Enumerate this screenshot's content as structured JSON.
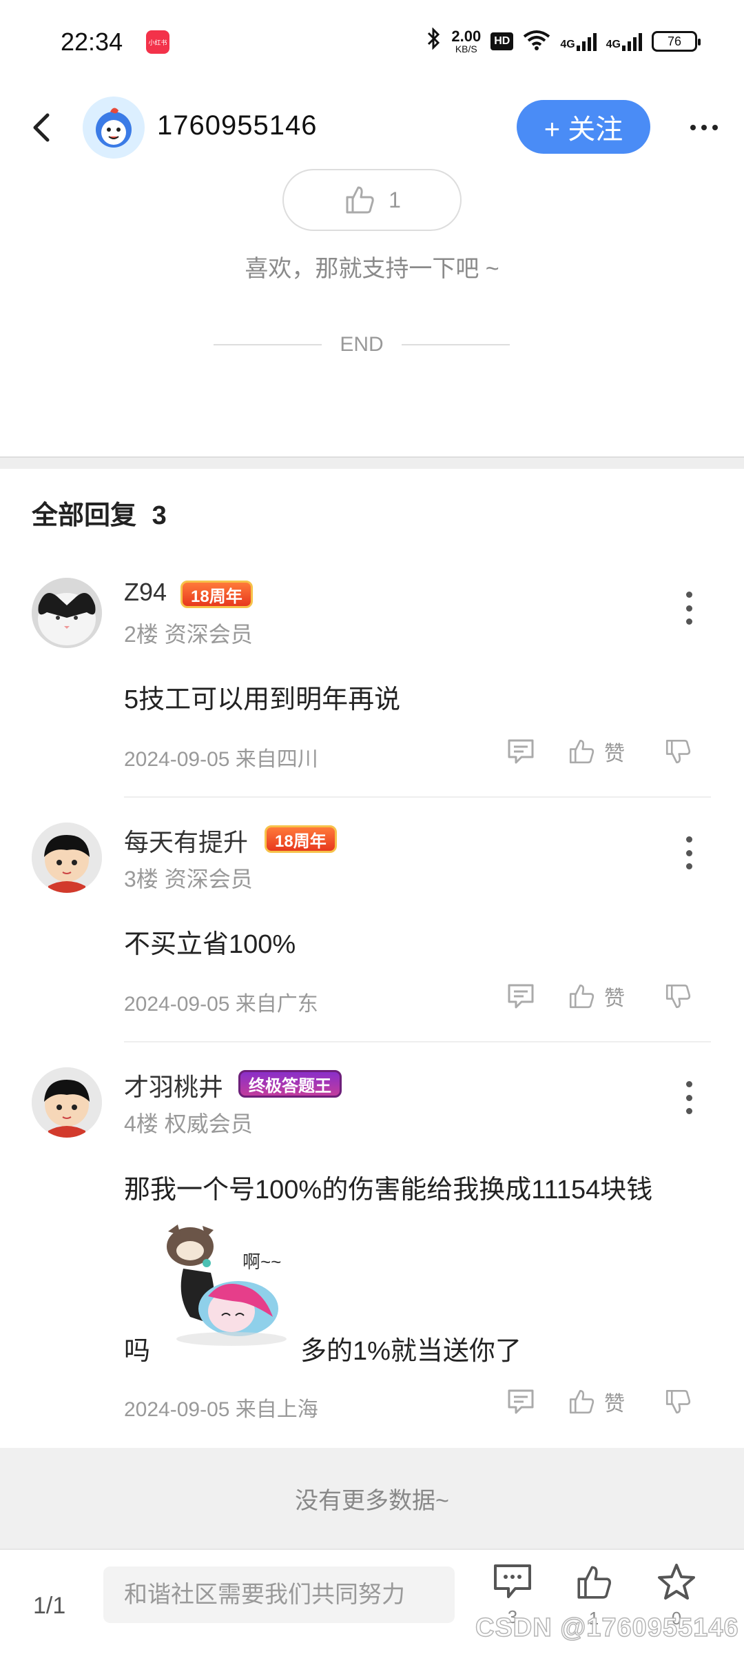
{
  "status_bar": {
    "time": "22:34",
    "app_badge": "小红书",
    "net_speed_value": "2.00",
    "net_speed_unit": "KB/S",
    "hd_label": "HD",
    "signal_1": "4G",
    "signal_2": "4G",
    "battery": "76"
  },
  "header": {
    "title": "1760955146",
    "follow_label": "+ 关注"
  },
  "post_end": {
    "like_count": "1",
    "like_hint": "喜欢，那就支持一下吧 ~",
    "end_label": "END"
  },
  "replies": {
    "title": "全部回复",
    "count": "3",
    "items": [
      {
        "name": "Z94",
        "badge": "18周年",
        "floor": "2楼 资深会员",
        "text": "5技工可以用到明年再说",
        "meta": "2024-09-05 来自四川",
        "like_label": "赞"
      },
      {
        "name": "每天有提升",
        "badge": "18周年",
        "floor": "3楼 资深会员",
        "text": "不买立省100%",
        "meta": "2024-09-05 来自广东",
        "like_label": "赞"
      },
      {
        "name": "才羽桃井",
        "badge": "终极答题王",
        "floor": "4楼 权威会员",
        "text": "那我一个号100%的伤害能给我换成11154块钱",
        "text_before_sticker": "吗",
        "sticker_text": "啊~~",
        "text_after_sticker": "多的1%就当送你了",
        "meta": "2024-09-05 来自上海",
        "like_label": "赞"
      }
    ]
  },
  "no_more": "没有更多数据~",
  "bottom_bar": {
    "page_indicator": "1/1",
    "input_placeholder": "和谐社区需要我们共同努力",
    "comment_count": "3",
    "like_count": "1",
    "favorite_count": "0"
  },
  "watermark": "CSDN @1760955146",
  "colors": {
    "accent": "#4a8cf6",
    "text_primary": "#222222",
    "text_secondary": "#999999"
  }
}
